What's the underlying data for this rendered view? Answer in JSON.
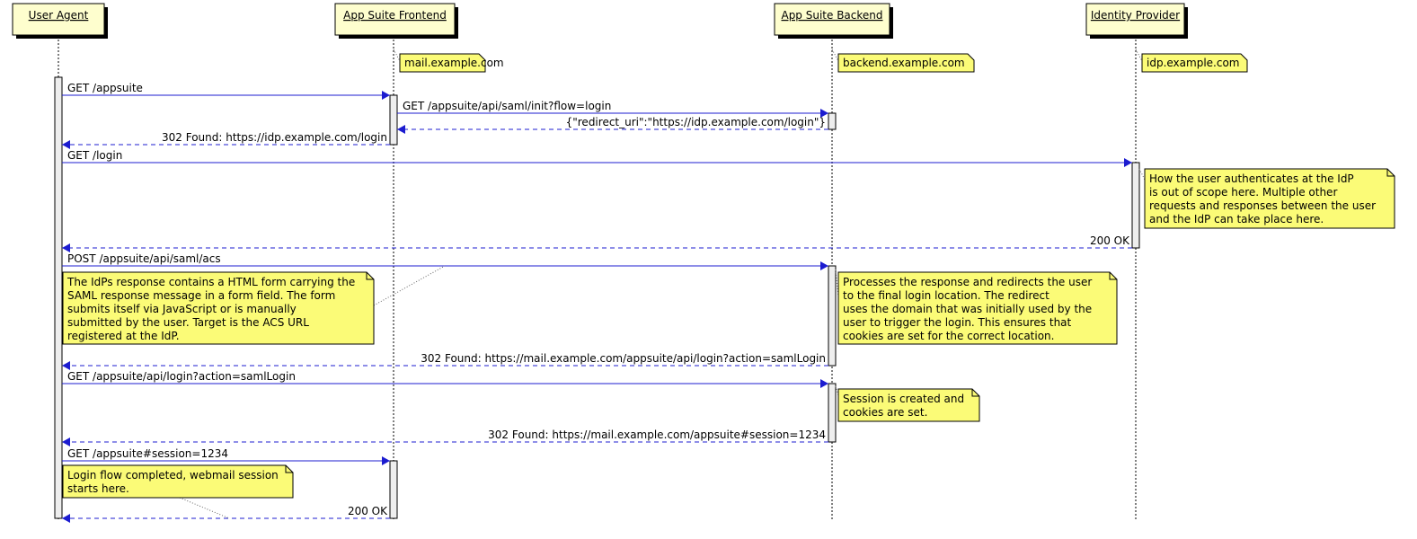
{
  "colors": {
    "participant_fill": "#FEFECE",
    "note_fill": "#FBFB77",
    "arrow": "#1C1CD0",
    "activation_fill": "#EEEEEE",
    "border": "#000000"
  },
  "participants": [
    {
      "id": "ua",
      "label": "User Agent"
    },
    {
      "id": "fe",
      "label": "App Suite Frontend",
      "note": "mail.example.com"
    },
    {
      "id": "be",
      "label": "App Suite Backend",
      "note": "backend.example.com"
    },
    {
      "id": "idp",
      "label": "Identity Provider",
      "note": "idp.example.com"
    }
  ],
  "messages": [
    {
      "from": "ua",
      "to": "fe",
      "label": "GET /appsuite",
      "dashed": false
    },
    {
      "from": "fe",
      "to": "be",
      "label": "GET /appsuite/api/saml/init?flow=login",
      "dashed": false
    },
    {
      "from": "be",
      "to": "fe",
      "label": "{\"redirect_uri\":\"https://idp.example.com/login\"}",
      "dashed": true
    },
    {
      "from": "fe",
      "to": "ua",
      "label": "302 Found: https://idp.example.com/login",
      "dashed": true
    },
    {
      "from": "ua",
      "to": "idp",
      "label": "GET /login",
      "dashed": false
    },
    {
      "from": "idp",
      "to": "ua",
      "label": "200 OK",
      "dashed": true
    },
    {
      "from": "ua",
      "to": "be",
      "label": "POST /appsuite/api/saml/acs",
      "dashed": false
    },
    {
      "from": "be",
      "to": "ua",
      "label": "302 Found: https://mail.example.com/appsuite/api/login?action=samlLogin",
      "dashed": true
    },
    {
      "from": "ua",
      "to": "be",
      "label": "GET /appsuite/api/login?action=samlLogin",
      "dashed": false
    },
    {
      "from": "be",
      "to": "ua",
      "label": "302 Found: https://mail.example.com/appsuite#session=1234",
      "dashed": true
    },
    {
      "from": "ua",
      "to": "fe",
      "label": "GET /appsuite#session=1234",
      "dashed": false
    },
    {
      "from": "fe",
      "to": "ua",
      "label": "200 OK",
      "dashed": true
    }
  ],
  "notes": [
    {
      "lines": [
        "How the user authenticates at the IdP",
        "is out of scope here. Multiple other",
        "requests and responses between the user",
        "and the IdP can take place here."
      ]
    },
    {
      "lines": [
        "The IdPs response contains a HTML form carrying the",
        "SAML response message in a form field. The form",
        "submits itself via JavaScript or is manually",
        "submitted by the user. Target is the ACS URL",
        "registered at the IdP."
      ]
    },
    {
      "lines": [
        "Processes the response and redirects the user",
        "to the final login location. The redirect",
        "uses the domain that was initially used by the",
        "user to trigger the login. This ensures that",
        "cookies are set for the correct location."
      ]
    },
    {
      "lines": [
        "Session is created and",
        "cookies are set."
      ]
    },
    {
      "lines": [
        "Login flow completed, webmail session",
        "starts here."
      ]
    }
  ]
}
